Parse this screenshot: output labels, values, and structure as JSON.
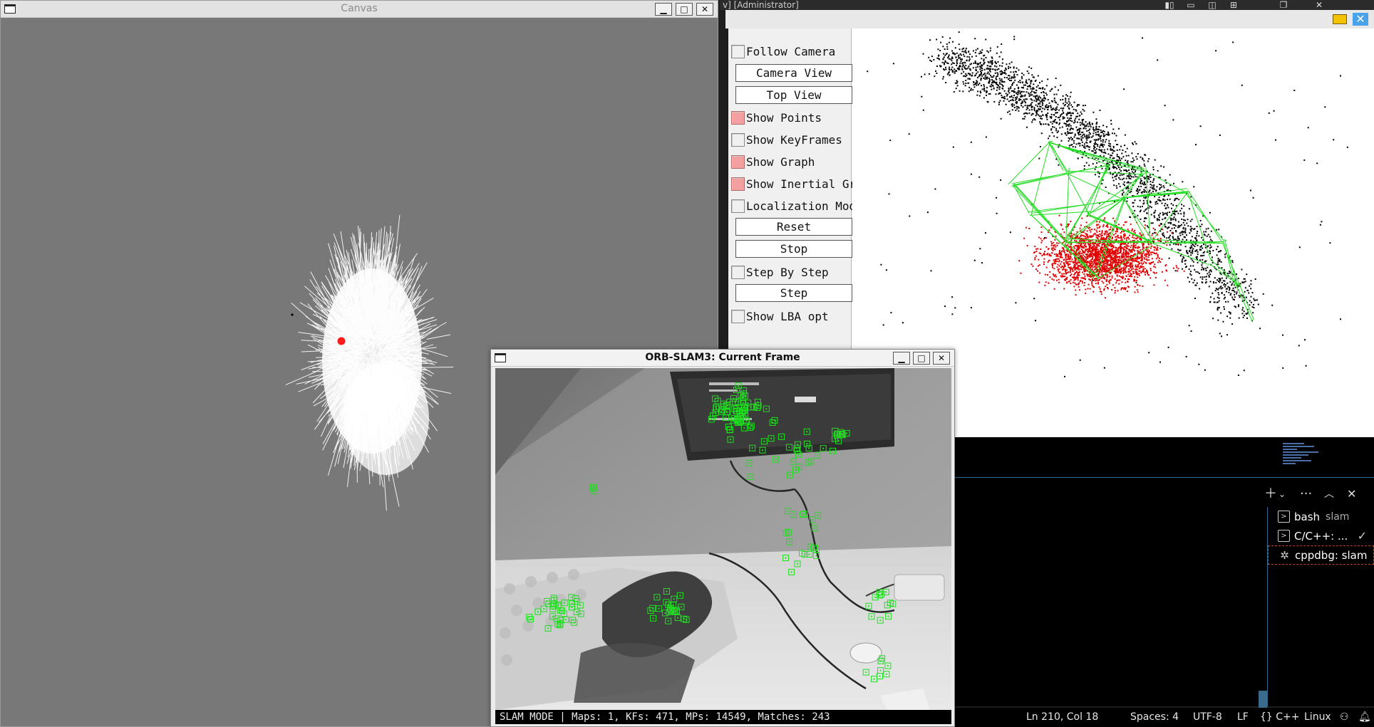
{
  "canvas_window": {
    "title": "Canvas"
  },
  "background_ide": {
    "window_title": "v] [Administrator]",
    "terminals": [
      {
        "name": "bash",
        "sub": "slam",
        "icon": "terminal-icon"
      },
      {
        "name": "C/C++: ...",
        "sub": "",
        "icon": "terminal-icon",
        "done": true
      },
      {
        "name": "cppdbg: slam",
        "sub": "",
        "icon": "debug-icon",
        "active": true
      }
    ],
    "statusbar": {
      "position": "Ln 210, Col 18",
      "spaces": "Spaces: 4",
      "encoding": "UTF-8",
      "eol": "LF",
      "language": "{} C++",
      "platform": "Linux"
    }
  },
  "map_viewer": {
    "panel": {
      "follow_camera": {
        "label": "Follow Camera",
        "checked": false
      },
      "camera_view": "Camera View",
      "top_view": "Top View",
      "show_points": {
        "label": "Show Points",
        "checked": true
      },
      "show_keyframes": {
        "label": "Show KeyFrames",
        "checked": false
      },
      "show_graph": {
        "label": "Show Graph",
        "checked": true
      },
      "show_inertial_graph": {
        "label": "Show Inertial Graph",
        "checked": true
      },
      "localization_mode": {
        "label": "Localization Mode",
        "checked": false
      },
      "reset": "Reset",
      "stop": "Stop",
      "step_by_step": {
        "label": "Step By Step",
        "checked": false
      },
      "step": "Step",
      "show_lba_opt": {
        "label": "Show LBA opt",
        "checked": false
      }
    }
  },
  "current_frame": {
    "title": "ORB-SLAM3: Current Frame",
    "status": "SLAM MODE |  Maps: 1, KFs: 471, MPs: 14549, Matches: 243"
  },
  "colors": {
    "map_points_black": "#000000",
    "map_points_red": "#e00000",
    "graph_green": "#22dd22",
    "feature_green": "#1ee01e",
    "canvas_bg": "#787878"
  }
}
